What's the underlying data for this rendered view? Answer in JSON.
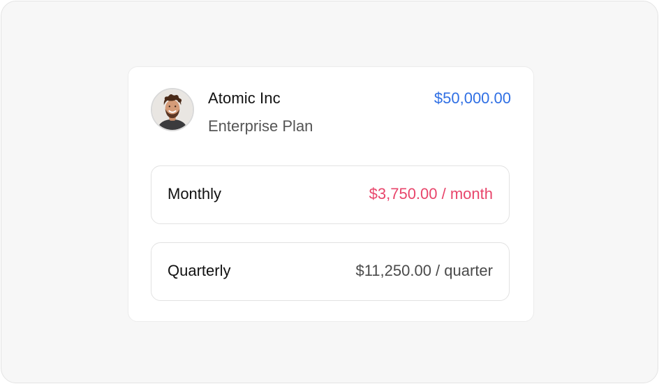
{
  "card": {
    "company_name": "Atomic Inc",
    "plan_name": "Enterprise Plan",
    "total_amount": "$50,000.00",
    "avatar_icon": "person-avatar-icon"
  },
  "billing_options": [
    {
      "label": "Monthly",
      "price": "$3,750.00 / month",
      "price_color": "#e8456b"
    },
    {
      "label": "Quarterly",
      "price": "$11,250.00 / quarter",
      "price_color": "#4a4a4a"
    }
  ],
  "colors": {
    "total_accent": "#2f6fe4",
    "monthly_accent": "#e8456b",
    "background": "#f7f7f7",
    "card": "#ffffff"
  }
}
